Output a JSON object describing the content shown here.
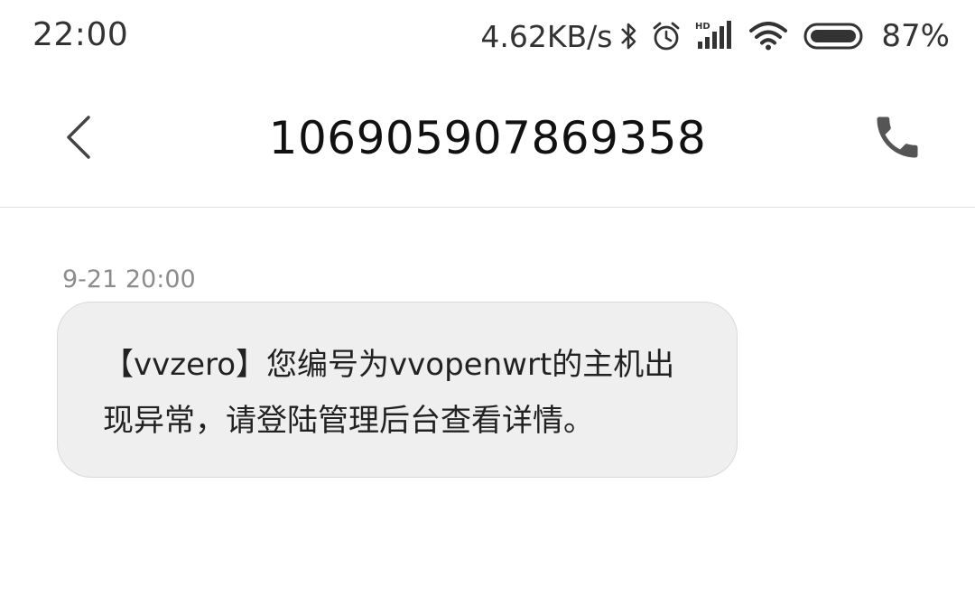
{
  "status_bar": {
    "time": "22:00",
    "net_speed": "4.62KB/s",
    "battery_percent": "87%",
    "icons": [
      "bluetooth-icon",
      "alarm-icon",
      "hd-signal-icon",
      "wifi-icon",
      "battery-icon"
    ]
  },
  "header": {
    "back_icon": "chevron-left-icon",
    "title": "106905907869358",
    "call_icon": "phone-icon"
  },
  "messages": [
    {
      "timestamp": "9-21 20:00",
      "text": "【vvzero】您编号为vvopenwrt的主机出现异常，请登陆管理后台查看详情。"
    }
  ],
  "colors": {
    "bubble_background": "#efefef",
    "timestamp": "#8c8c8c",
    "icon_gray": "#555555"
  }
}
